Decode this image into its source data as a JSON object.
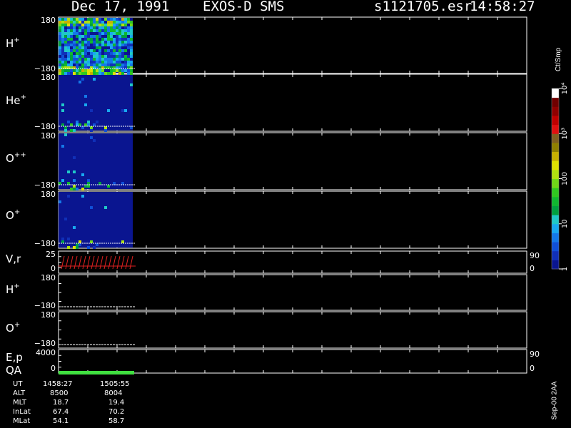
{
  "header": {
    "date": "Dec 17, 1991",
    "mission": "EXOS-D SMS",
    "file": "s1121705.esr",
    "time": "14:58:27"
  },
  "colorbar": {
    "unit": "Ct/Smp",
    "ticks": [
      {
        "label": "1",
        "value": 1
      },
      {
        "label": "10",
        "value": 10
      },
      {
        "label": "100",
        "value": 100
      },
      {
        "label": "10³",
        "value": 1000
      },
      {
        "label": "10⁴",
        "value": 10000
      }
    ],
    "colors": [
      "#0a1590",
      "#1030b8",
      "#1050d8",
      "#1478e8",
      "#18a8f0",
      "#20c8c8",
      "#00a040",
      "#10b830",
      "#30c820",
      "#70d818",
      "#b0e010",
      "#e0e000",
      "#c8b000",
      "#908000",
      "#806020",
      "#e01010",
      "#c00000",
      "#900000",
      "#700000",
      "#ffffff"
    ]
  },
  "panels": [
    {
      "label": "H",
      "sup": "+",
      "ymax": "180",
      "ymin": "−180"
    },
    {
      "label": "He",
      "sup": "+",
      "ymax": "180",
      "ymin": "−180"
    },
    {
      "label": "O",
      "sup": "++",
      "ymax": "180",
      "ymin": "−180"
    },
    {
      "label": "O",
      "sup": "+",
      "ymax": "180",
      "ymin": "−180"
    },
    {
      "label": "V,r",
      "sup": "",
      "ymax": "25",
      "ymin": "0",
      "rmax": "90",
      "rmin": "0"
    },
    {
      "label": "H",
      "sup": "+",
      "ymax": "180",
      "ymin": "−180"
    },
    {
      "label": "O",
      "sup": "+",
      "ymax": "180",
      "ymin": "−180"
    },
    {
      "label": "E,p",
      "label2": "QA",
      "sup": "",
      "ymax": "4000",
      "ymin": "0",
      "rmax": "90",
      "rmin": "0"
    }
  ],
  "orbit": {
    "rows": [
      {
        "name": "UT",
        "v1": "1458:27",
        "v2": "1505:55"
      },
      {
        "name": "ALT",
        "v1": "8500",
        "v2": "8004"
      },
      {
        "name": "MLT",
        "v1": "18.7",
        "v2": "19.4"
      },
      {
        "name": "InLat",
        "v1": "67.4",
        "v2": "70.2"
      },
      {
        "name": "MLat",
        "v1": "54.1",
        "v2": "58.7"
      }
    ]
  },
  "version": "Sep-00 2AA",
  "chart_data": {
    "type": "heatmap",
    "title": "Dec 17, 1991   EXOS-D SMS",
    "x_range": [
      "1458:27",
      "1505:55"
    ],
    "y_range": [
      -180,
      180
    ],
    "color_scale": "log",
    "color_range": [
      1,
      10000
    ],
    "series": [
      {
        "name": "H+",
        "values": []
      },
      {
        "name": "He+",
        "values": []
      },
      {
        "name": "O++",
        "values": []
      },
      {
        "name": "O+",
        "values": []
      }
    ]
  }
}
